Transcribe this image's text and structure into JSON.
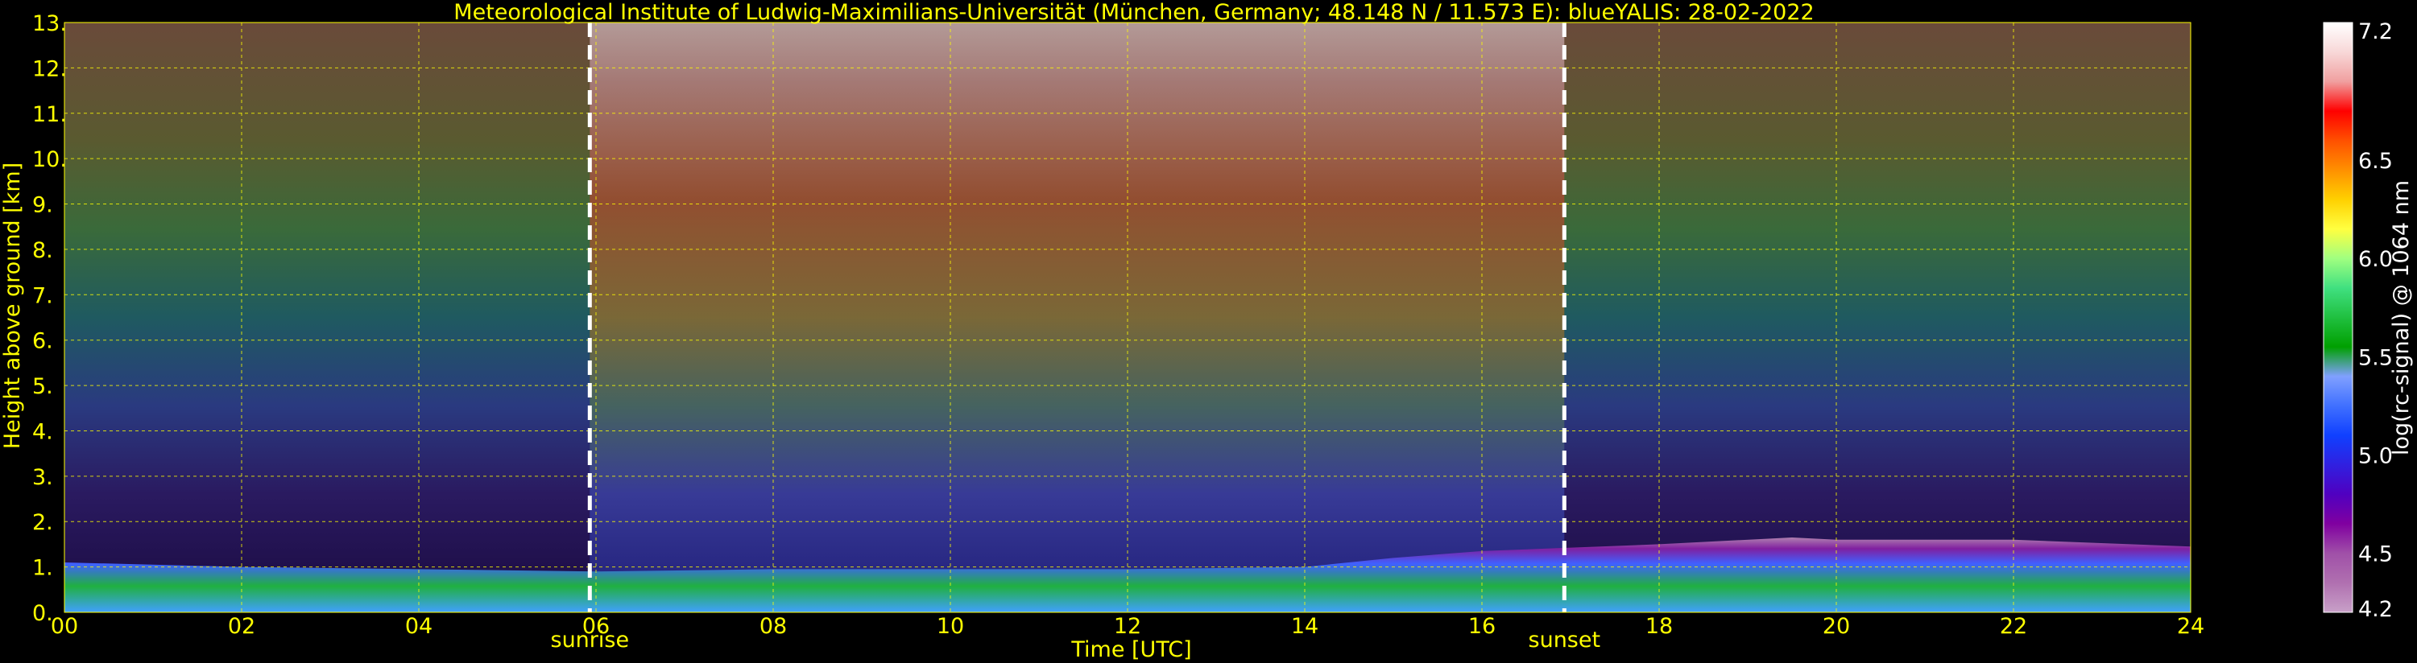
{
  "chart_data": {
    "type": "heatmap",
    "title": "Meteorological Institute of Ludwig-Maximilians-Universität (München, Germany; 48.148 N / 11.573 E):    blueYALIS: 28-02-2022",
    "xlabel": "Time [UTC]",
    "ylabel": "Height above ground [km]",
    "xlim": [
      0,
      24
    ],
    "ylim": [
      0,
      13
    ],
    "x_ticks": [
      "00",
      "02",
      "04",
      "06",
      "08",
      "10",
      "12",
      "14",
      "16",
      "18",
      "20",
      "22",
      "24"
    ],
    "y_ticks": [
      "0.",
      "1.",
      "2.",
      "3.",
      "4.",
      "5.",
      "6.",
      "7.",
      "8.",
      "9.",
      "10.",
      "11.",
      "12.",
      "13."
    ],
    "grid": true,
    "events": [
      {
        "name": "sunrise",
        "x": 5.93
      },
      {
        "name": "sunset",
        "x": 16.93
      }
    ],
    "colorbar": {
      "label": "log(rc-signal) @ 1064 nm",
      "range": [
        4.2,
        7.2
      ],
      "ticks": [
        "7.2",
        "6.5",
        "6.0",
        "5.5",
        "5.0",
        "4.5",
        "4.2"
      ],
      "tick_values": [
        7.2,
        6.5,
        6.0,
        5.5,
        5.0,
        4.5,
        4.2
      ],
      "colors": [
        "#c8a0c8",
        "#b070b0",
        "#a050a8",
        "#8000a0",
        "#5000c0",
        "#3020e0",
        "#1040ff",
        "#4070ff",
        "#80a0ff",
        "#00a000",
        "#20c040",
        "#40e080",
        "#a0ff80",
        "#ffff40",
        "#ffd000",
        "#ff9000",
        "#ff5000",
        "#ff0000",
        "#f0a0a0",
        "#f8d8d8",
        "#ffffff"
      ]
    },
    "boundary_layer_top_km": [
      [
        0,
        1.1
      ],
      [
        2,
        1.0
      ],
      [
        4,
        0.95
      ],
      [
        6,
        0.9
      ],
      [
        8,
        0.95
      ],
      [
        10,
        0.95
      ],
      [
        12,
        0.95
      ],
      [
        14,
        1.0
      ],
      [
        15,
        1.2
      ],
      [
        16,
        1.35
      ],
      [
        18,
        1.5
      ],
      [
        19.5,
        1.65
      ],
      [
        20,
        1.6
      ],
      [
        22,
        1.6
      ],
      [
        24,
        1.45
      ]
    ]
  },
  "colors": {
    "text": "#ffff00",
    "grid": "#ffff00",
    "background": "#000000",
    "event_line": "#ffffff"
  }
}
